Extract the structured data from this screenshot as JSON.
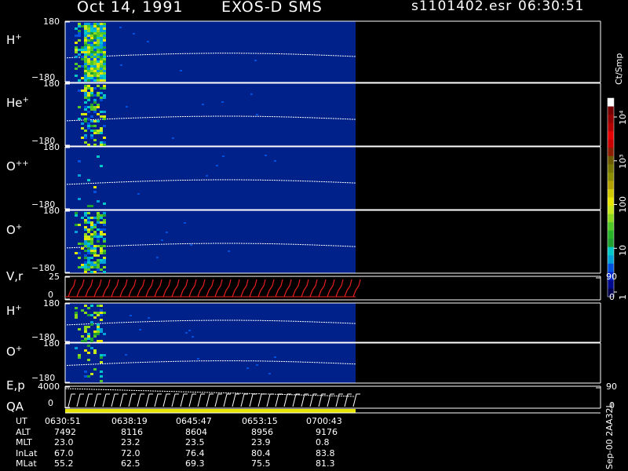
{
  "header": {
    "date": "Oct 14, 1991",
    "instrument": "EXOS-D SMS",
    "file": "s1101402.esr",
    "time": "06:30:51"
  },
  "colorbar": {
    "label": "Ct/Smp",
    "ticks": [
      {
        "value": 1,
        "text": "1"
      },
      {
        "value": 10,
        "text": "10"
      },
      {
        "value": 100,
        "text": "100"
      },
      {
        "value": 1000,
        "text": "10³"
      },
      {
        "value": 10000,
        "text": "10⁴"
      }
    ],
    "colors": [
      "#00004f",
      "#000a8f",
      "#0026c8",
      "#0050e0",
      "#00a0d8",
      "#00c8c8",
      "#1fa030",
      "#28b428",
      "#50c828",
      "#8cd81e",
      "#c8e81e",
      "#e6e600",
      "#d2c800",
      "#b4a000",
      "#8c8c00",
      "#787800",
      "#6e5a00",
      "#8c1e00",
      "#c80000",
      "#e60000",
      "#b40000",
      "#960000",
      "#780000",
      "#ffffff"
    ]
  },
  "footer_note": "Sep-00 2AA32L",
  "chart_data": {
    "type": "heatmap",
    "x_time_ticks": [
      "0630:51",
      "0638:19",
      "0645:47",
      "0653:15",
      "0700:43"
    ],
    "panels": [
      {
        "label_main": "H",
        "label_sup": "+",
        "ytop": "180",
        "ybot": "−180",
        "ylim": [
          -180,
          180
        ],
        "burst": "strong"
      },
      {
        "label_main": "He",
        "label_sup": "+",
        "ytop": "180",
        "ybot": "−180",
        "ylim": [
          -180,
          180
        ],
        "burst": "weak"
      },
      {
        "label_main": "O",
        "label_sup": "++",
        "ytop": "180",
        "ybot": "−180",
        "ylim": [
          -180,
          180
        ],
        "burst": "none"
      },
      {
        "label_main": "O",
        "label_sup": "+",
        "ytop": "180",
        "ybot": "−180",
        "ylim": [
          -180,
          180
        ],
        "burst": "medium"
      },
      {
        "label_main": "V,r",
        "label_sup": "",
        "ytop": "25",
        "ybot": "0",
        "ylim": [
          0,
          25
        ],
        "right_top": "90",
        "right_bot": "0",
        "kind": "line"
      },
      {
        "label_main": "H",
        "label_sup": "+",
        "ytop": "180",
        "ybot": "−180",
        "ylim": [
          -180,
          180
        ],
        "burst": "weak2"
      },
      {
        "label_main": "O",
        "label_sup": "+",
        "ytop": "180",
        "ybot": "−180",
        "ylim": [
          -180,
          180
        ],
        "burst": "faint"
      },
      {
        "label_main": "E,p",
        "label_sup": "",
        "ytop": "4000",
        "ybot": "0",
        "ylim": [
          0,
          4000
        ],
        "right_top": "90",
        "right_bot": "0",
        "kind": "line2"
      }
    ],
    "qa_label": "QA",
    "ephemeris": [
      {
        "name": "UT",
        "values": [
          "0630:51",
          "0638:19",
          "0645:47",
          "0653:15",
          "0700:43"
        ]
      },
      {
        "name": "ALT",
        "values": [
          "7492",
          "8116",
          "8604",
          "8956",
          "9176"
        ]
      },
      {
        "name": "MLT",
        "values": [
          "23.0",
          "23.2",
          "23.5",
          "23.9",
          "0.8"
        ]
      },
      {
        "name": "InLat",
        "values": [
          "67.0",
          "72.0",
          "76.4",
          "80.4",
          "83.8"
        ]
      },
      {
        "name": "MLat",
        "values": [
          "55.2",
          "62.5",
          "69.3",
          "75.5",
          "81.3"
        ]
      }
    ]
  }
}
